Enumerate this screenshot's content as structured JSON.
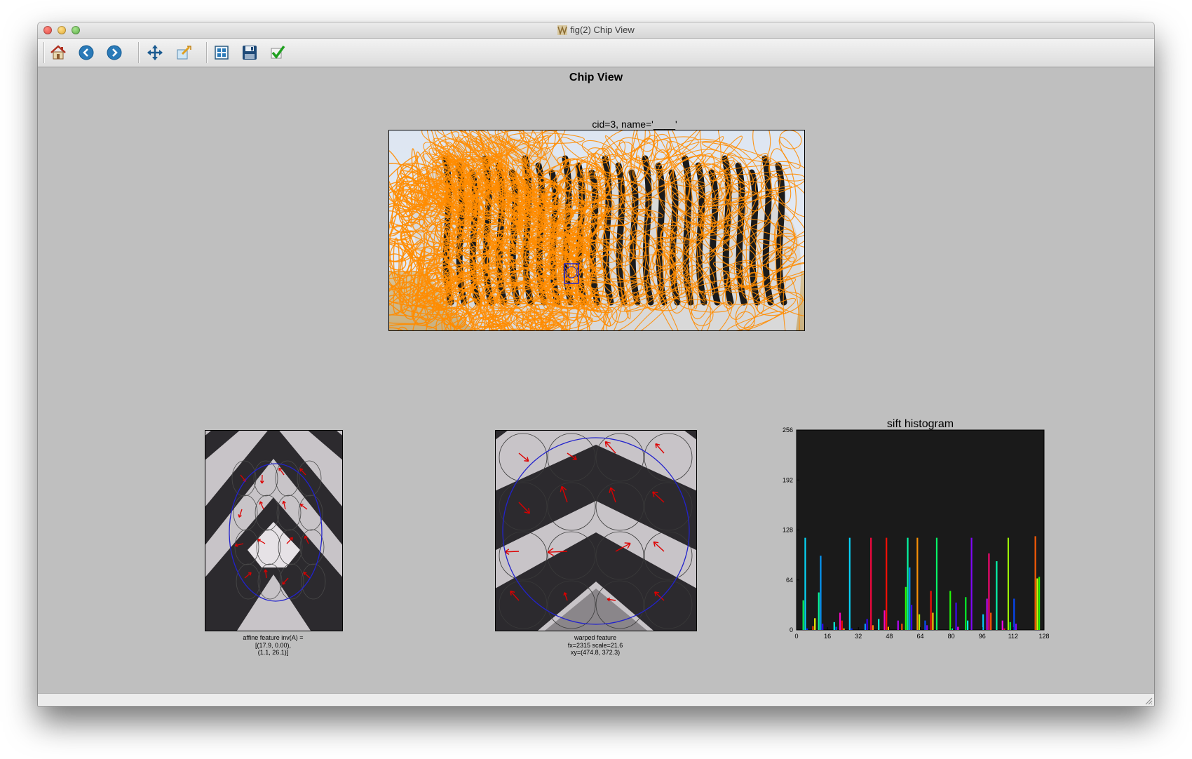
{
  "window": {
    "title": "fig(2) Chip View"
  },
  "toolbar": {
    "buttons": [
      {
        "id": "home",
        "icon": "home-icon"
      },
      {
        "id": "back",
        "icon": "arrow-left-icon"
      },
      {
        "id": "forward",
        "icon": "arrow-right-icon"
      },
      {
        "id": "pan",
        "icon": "move-icon"
      },
      {
        "id": "zoom",
        "icon": "zoom-icon"
      },
      {
        "id": "configure",
        "icon": "subplots-icon"
      },
      {
        "id": "save",
        "icon": "floppy-disk-icon"
      },
      {
        "id": "edit",
        "icon": "checkmark-icon"
      }
    ]
  },
  "figure": {
    "suptitle": "Chip View",
    "chip_title": "cid=3, name='____'",
    "affine_caption": [
      "affine feature inv(A) =",
      "[(17.9,  0.00),",
      "(1.1, 26.1)]"
    ],
    "warped_caption": [
      "warped feature",
      "fx=2315 scale=21.6",
      "xy=(474.8, 372.3)"
    ]
  },
  "colors": {
    "keypoint_ellipse": "#ff8c00",
    "feature_ellipse": "#2222cc",
    "arrow": "#dd0000",
    "histogram_bg": "#1a1a1a",
    "figure_bg": "#bfbfbf"
  },
  "chart_data": {
    "type": "bar",
    "title": "sift histogram",
    "xlabel": "",
    "ylabel": "",
    "xlim": [
      0,
      128
    ],
    "ylim": [
      0,
      256
    ],
    "xticks": [
      0,
      16,
      32,
      48,
      64,
      80,
      96,
      112,
      128
    ],
    "yticks": [
      0,
      64,
      128,
      192,
      256
    ],
    "grid": false,
    "values": [
      0,
      0,
      0,
      38,
      118,
      2,
      0,
      0,
      5,
      15,
      0,
      48,
      95,
      8,
      0,
      0,
      0,
      0,
      0,
      10,
      4,
      0,
      22,
      12,
      2,
      0,
      0,
      118,
      2,
      0,
      0,
      0,
      0,
      0,
      0,
      8,
      14,
      0,
      118,
      6,
      0,
      0,
      14,
      0,
      0,
      25,
      118,
      4,
      0,
      0,
      0,
      0,
      12,
      0,
      8,
      0,
      55,
      118,
      80,
      32,
      0,
      0,
      118,
      20,
      0,
      0,
      12,
      6,
      0,
      50,
      22,
      0,
      118,
      0,
      0,
      0,
      0,
      0,
      0,
      50,
      2,
      0,
      35,
      4,
      0,
      0,
      0,
      42,
      12,
      0,
      118,
      0,
      0,
      0,
      0,
      0,
      20,
      0,
      40,
      98,
      22,
      0,
      0,
      88,
      0,
      0,
      12,
      2,
      0,
      118,
      10,
      0,
      40,
      8,
      0,
      0,
      0,
      0,
      0,
      0,
      0,
      0,
      0,
      120,
      66,
      68,
      0,
      0
    ]
  }
}
